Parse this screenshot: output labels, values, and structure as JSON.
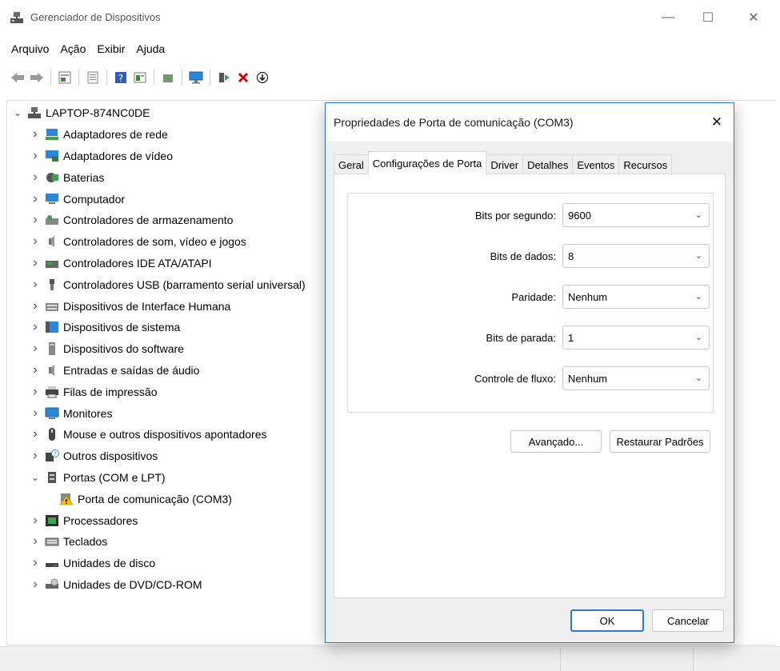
{
  "window": {
    "title": "Gerenciador de Dispositivos",
    "minimize_glyph": "—",
    "maximize_glyph": "☐",
    "close_glyph": "✕"
  },
  "menu": [
    "Arquivo",
    "Ação",
    "Exibir",
    "Ajuda"
  ],
  "toolbar": {
    "icons": [
      "back-arrow-icon",
      "forward-arrow-icon",
      "properties-view-icon",
      "device-list-icon",
      "help-icon",
      "resource-view-icon",
      "scan-hardware-icon",
      "monitor-icon",
      "enable-device-icon",
      "uninstall-device-icon",
      "update-driver-icon"
    ]
  },
  "tree": {
    "root": "LAPTOP-874NC0DE",
    "items": [
      {
        "label": "Adaptadores de rede",
        "icon": "network-adapter-icon"
      },
      {
        "label": "Adaptadores de vídeo",
        "icon": "display-adapter-icon"
      },
      {
        "label": "Baterias",
        "icon": "battery-icon"
      },
      {
        "label": "Computador",
        "icon": "computer-icon"
      },
      {
        "label": "Controladores de armazenamento",
        "icon": "storage-controller-icon"
      },
      {
        "label": "Controladores de som, vídeo e jogos",
        "icon": "sound-icon"
      },
      {
        "label": "Controladores IDE ATA/ATAPI",
        "icon": "ide-controller-icon"
      },
      {
        "label": "Controladores USB (barramento serial universal)",
        "icon": "usb-icon"
      },
      {
        "label": "Dispositivos de Interface Humana",
        "icon": "hid-icon"
      },
      {
        "label": "Dispositivos de sistema",
        "icon": "system-device-icon"
      },
      {
        "label": "Dispositivos do software",
        "icon": "software-device-icon"
      },
      {
        "label": "Entradas e saídas de áudio",
        "icon": "audio-io-icon"
      },
      {
        "label": "Filas de impressão",
        "icon": "printer-icon"
      },
      {
        "label": "Monitores",
        "icon": "monitor-icon"
      },
      {
        "label": "Mouse e outros dispositivos apontadores",
        "icon": "mouse-icon"
      },
      {
        "label": "Outros dispositivos",
        "icon": "other-devices-icon"
      },
      {
        "label": "Portas (COM e LPT)",
        "icon": "port-icon",
        "expanded": true
      },
      {
        "label": "Porta de comunicação (COM3)",
        "icon": "com-port-warning-icon",
        "child": true
      },
      {
        "label": "Processadores",
        "icon": "processor-icon"
      },
      {
        "label": "Teclados",
        "icon": "keyboard-icon"
      },
      {
        "label": "Unidades de disco",
        "icon": "disk-drive-icon"
      },
      {
        "label": "Unidades de DVD/CD-ROM",
        "icon": "dvd-drive-icon"
      }
    ]
  },
  "dialog": {
    "title": "Propriedades de Porta de comunicação (COM3)",
    "close_glyph": "✕",
    "tabs": [
      "Geral",
      "Configurações de Porta",
      "Driver",
      "Detalhes",
      "Eventos",
      "Recursos"
    ],
    "active_tab": "Configurações de Porta",
    "fields": [
      {
        "label": "Bits por segundo:",
        "value": "9600"
      },
      {
        "label": "Bits de dados:",
        "value": "8"
      },
      {
        "label": "Paridade:",
        "value": "Nenhum"
      },
      {
        "label": "Bits de parada:",
        "value": "1"
      },
      {
        "label": "Controle de fluxo:",
        "value": "Nenhum"
      }
    ],
    "advanced_button": "Avançado...",
    "restore_button": "Restaurar Padrões",
    "ok_button": "OK",
    "cancel_button": "Cancelar"
  },
  "colors": {
    "accent": "#2b78d4",
    "warning": "#f2c200",
    "uninstall": "#d40000"
  }
}
